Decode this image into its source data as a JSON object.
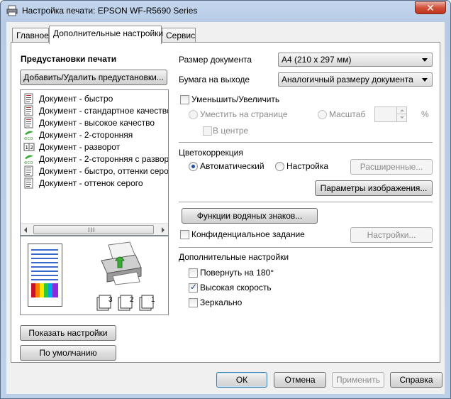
{
  "window": {
    "title": "Настройка печати: EPSON WF-R5690 Series",
    "close_glyph": "✕"
  },
  "tabs": [
    {
      "label": "Главное"
    },
    {
      "label": "Дополнительные настройки"
    },
    {
      "label": "Сервис"
    }
  ],
  "presets": {
    "heading": "Предустановки печати",
    "add_remove_button": "Добавить/Удалить предустановки...",
    "items": [
      {
        "label": "Документ - быстро",
        "icon": "document-fast-icon"
      },
      {
        "label": "Документ - стандартное качество",
        "icon": "document-standard-icon"
      },
      {
        "label": "Документ - высокое качество",
        "icon": "document-high-quality-icon"
      },
      {
        "label": "Документ - 2-сторонняя",
        "icon": "eco-icon"
      },
      {
        "label": "Документ - разворот",
        "icon": "two-up-icon"
      },
      {
        "label": "Документ - 2-сторонняя с разворотом",
        "icon": "eco-icon"
      },
      {
        "label": "Документ - быстро, оттенки серого",
        "icon": "document-gray-icon"
      },
      {
        "label": "Документ - оттенок серого",
        "icon": "document-gray-icon"
      }
    ],
    "scroll_grip": "III"
  },
  "preview": {
    "collate_labels": [
      "3",
      "2",
      "1"
    ]
  },
  "left_buttons": {
    "show_settings": "Показать настройки",
    "defaults": "По умолчанию"
  },
  "document": {
    "size_label": "Размер документа",
    "size_value": "A4 (210 x 297 мм)",
    "output_label": "Бумага на выходе",
    "output_value": "Аналогичный размеру документа"
  },
  "scaling": {
    "reduce_enlarge_label": "Уменьшить/Увеличить",
    "fit_to_page_label": "Уместить на странице",
    "scale_label": "Масштаб",
    "percent_sign": "%",
    "center_label": "В центре"
  },
  "color_correction": {
    "heading": "Цветокоррекция",
    "auto_label": "Автоматический",
    "custom_label": "Настройка",
    "advanced_button": "Расширенные...",
    "image_options_button": "Параметры изображения..."
  },
  "watermark": {
    "button": "Функции водяных знаков...",
    "confidential_label": "Конфиденциальное задание",
    "settings_button": "Настройки..."
  },
  "extra": {
    "heading": "Дополнительные настройки",
    "rotate_label": "Повернуть на 180°",
    "high_speed_label": "Высокая скорость",
    "high_speed_checked": true,
    "mirror_label": "Зеркально",
    "check_glyph": "✓"
  },
  "footer": {
    "ok": "ОК",
    "cancel": "Отмена",
    "apply": "Применить",
    "help": "Справка"
  },
  "colors": {
    "selected_radio": "#1d4fa0",
    "eco_green": "#3aa935"
  }
}
